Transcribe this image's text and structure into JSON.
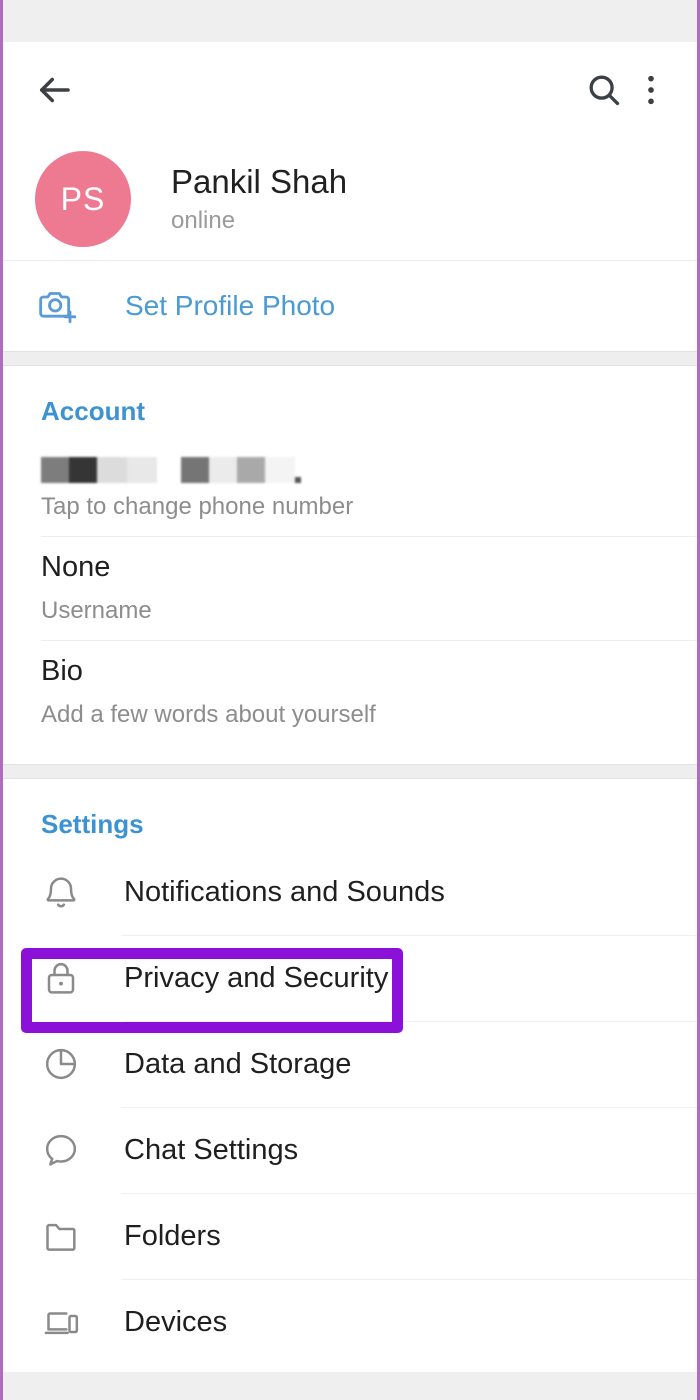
{
  "app": {
    "name": "Telegram Settings",
    "status_bar_color": "#efefef",
    "accent_blue": "#3c93d4",
    "highlight_purple": "#8b11d8",
    "avatar_color": "#ee7a92",
    "frame_border_color": "#b06dc0"
  },
  "appbar": {
    "back_icon": "back-arrow-icon",
    "search_icon": "search-icon",
    "menu_icon": "overflow-menu-icon"
  },
  "profile": {
    "avatar_initials": "PS",
    "name": "Pankil Shah",
    "status": "online"
  },
  "set_profile_photo": {
    "icon": "camera-add-icon",
    "label": "Set Profile Photo"
  },
  "account": {
    "title": "Account",
    "rows": [
      {
        "primary": "",
        "primary_redacted": true,
        "secondary": "Tap to change phone number",
        "name": "phone-number-row"
      },
      {
        "primary": "None",
        "primary_redacted": false,
        "secondary": "Username",
        "name": "username-row"
      },
      {
        "primary": "Bio",
        "primary_redacted": false,
        "secondary": "Add a few words about yourself",
        "name": "bio-row"
      }
    ]
  },
  "settings": {
    "title": "Settings",
    "items": [
      {
        "label": "Notifications and Sounds",
        "icon": "bell-icon",
        "highlighted": false
      },
      {
        "label": "Privacy and Security",
        "icon": "lock-icon",
        "highlighted": true
      },
      {
        "label": "Data and Storage",
        "icon": "pie-chart-icon",
        "highlighted": false
      },
      {
        "label": "Chat Settings",
        "icon": "speech-bubble-icon",
        "highlighted": false
      },
      {
        "label": "Folders",
        "icon": "folder-icon",
        "highlighted": false
      },
      {
        "label": "Devices",
        "icon": "devices-icon",
        "highlighted": false
      }
    ]
  }
}
